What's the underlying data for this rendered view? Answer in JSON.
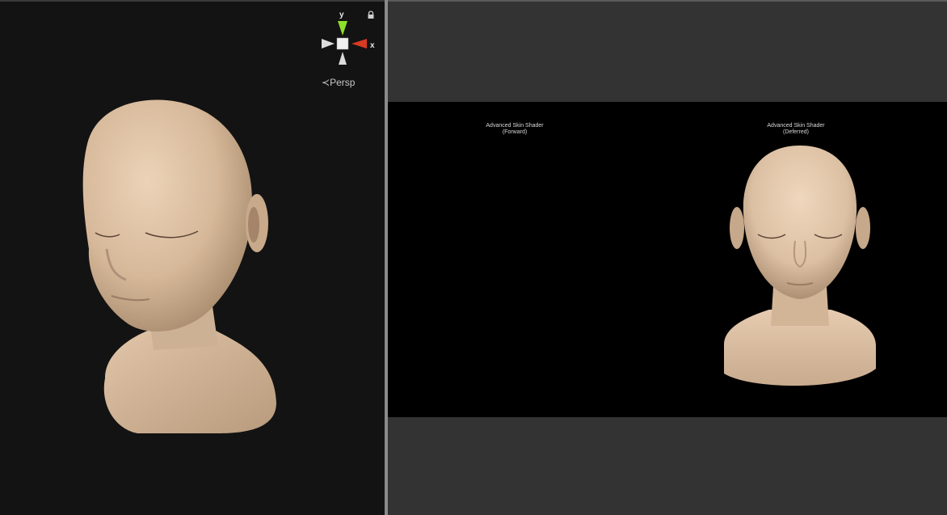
{
  "scene": {
    "projection_label": "Persp",
    "axis_y": "y",
    "axis_x": "x"
  },
  "game": {
    "caption_forward_title": "Advanced Skin Shader",
    "caption_forward_mode": "(Forward)",
    "caption_deferred_title": "Advanced Skin Shader",
    "caption_deferred_mode": "(Deferred)"
  },
  "colors": {
    "scene_bg": "#131313",
    "game_bg": "#333333",
    "render_bg": "#000000",
    "skin": "#d9bea2",
    "gizmo_y": "#8ee02a",
    "gizmo_x": "#d93a22"
  }
}
